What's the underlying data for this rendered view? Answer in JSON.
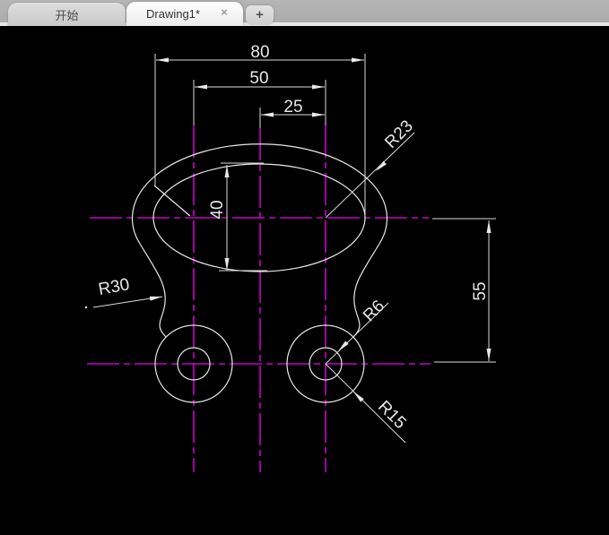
{
  "window": {
    "tabs": [
      {
        "label": "开始",
        "active": false
      },
      {
        "label": "Drawing1*",
        "active": true,
        "close_icon": "×"
      }
    ],
    "new_tab_icon": "+"
  },
  "drawing": {
    "dimensions": {
      "overall_width": "80",
      "hole_spacing": "50",
      "half_spacing": "25",
      "slot_height": "40",
      "center_height": "55"
    },
    "radii": {
      "top_corner": "R23",
      "side_fillet": "R30",
      "hole_inner": "R6",
      "hole_outer": "R15"
    },
    "colors": {
      "centerline": "#C800C8",
      "geometry": "#E8E8E8",
      "canvas_bg": "#000000",
      "tabbar_bg": "#AFAFAF"
    }
  }
}
